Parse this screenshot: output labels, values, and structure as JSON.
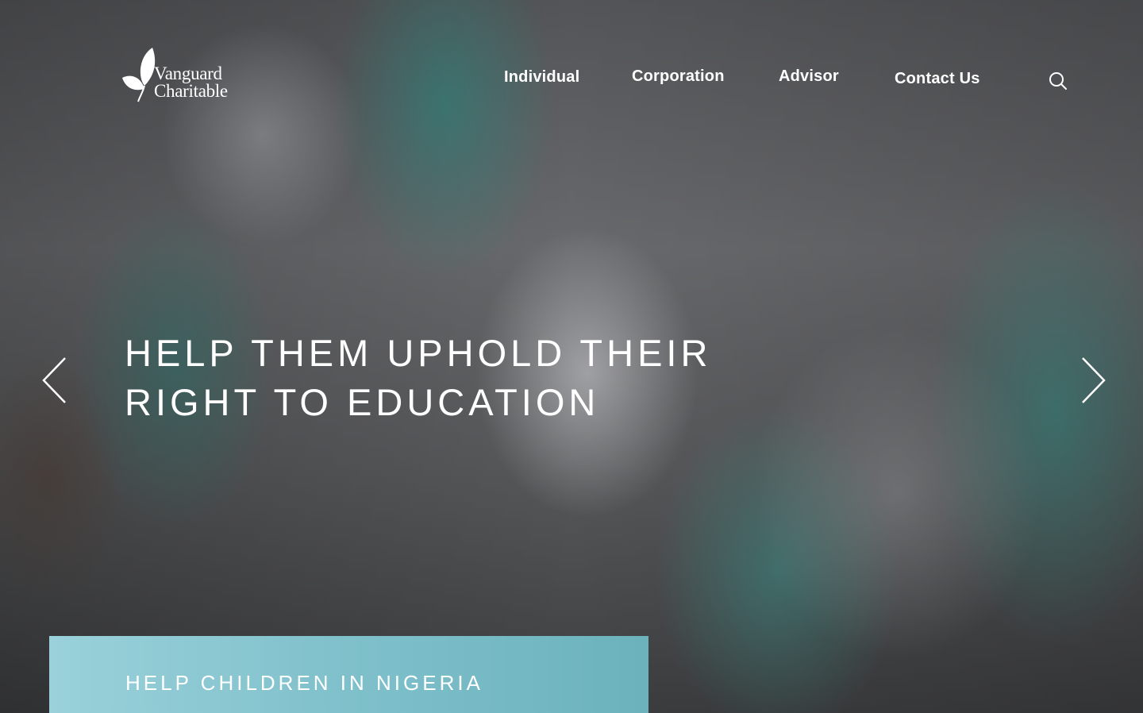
{
  "brand": {
    "logo_line1": "Vanguard",
    "logo_line2": "Charitable",
    "logo_icon": "leaf-icon"
  },
  "nav": {
    "items": [
      {
        "label": "Individual"
      },
      {
        "label": "Corporation"
      },
      {
        "label": "Advisor"
      },
      {
        "label": "Contact Us"
      }
    ],
    "search_icon": "search-icon"
  },
  "hero": {
    "headline_line1": "HELP THEM UPHOLD THEIR",
    "headline_line2": "RIGHT TO EDUCATION",
    "prev_icon": "chevron-left-icon",
    "next_icon": "chevron-right-icon",
    "cta_label": "HELP CHILDREN IN NIGERIA"
  },
  "colors": {
    "cta_start": "#9ad1da",
    "cta_end": "#6bb2bd",
    "text": "#ffffff"
  }
}
